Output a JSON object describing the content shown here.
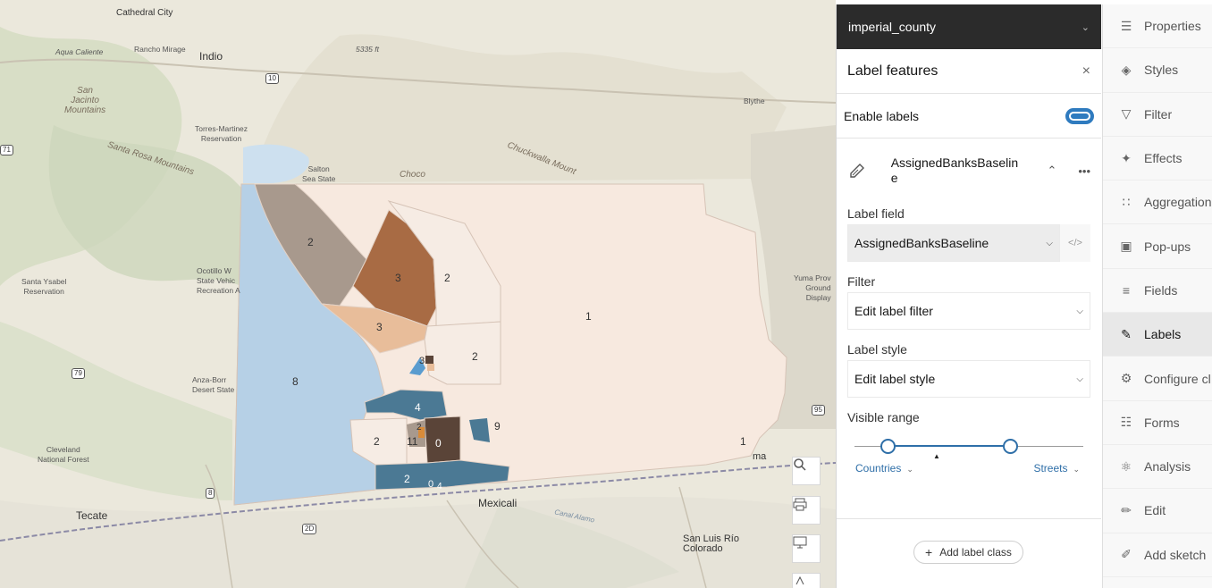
{
  "map": {
    "places": {
      "cathedral_city": "Cathedral City",
      "rancho_mirage": "Rancho Mirage",
      "indio": "Indio",
      "aqua_caliente": "Aqua Caliente",
      "elev": "5335 ft",
      "san_jacinto": "San\nJacinto\nMountains",
      "torres_martinez": "Torres-Martinez\nReservation",
      "santa_rosa": "Santa Rosa Mountains",
      "salton": "Salton\nSea State",
      "blythe": "Blythe",
      "chuckwalla": "Chuckwalla Mount",
      "santa_ysabel": "Santa Ysabel\nReservation",
      "ocotillo": "Ocotillo W\nState Vehic\nRecreation A",
      "anza_borrego": "Anza-Borr\nDesert State",
      "yuma_proving": "Yuma Prov\nGround\nDisplay",
      "cleveland": "Cleveland\nNational Forest",
      "tecate": "Tecate",
      "mexicali": "Mexicali",
      "canal_alamo": "Canal Alamo",
      "san_luis": "San Luis Río\nColorado",
      "yuma": "ma",
      "chocolate": "Choco"
    },
    "shields": {
      "i10": "10",
      "i171": "71",
      "r79": "79",
      "r8": "8",
      "r2d": "2D",
      "us95": "95"
    },
    "polygon_labels": {
      "a": "2",
      "b": "3",
      "c": "2",
      "d": "3",
      "e": "1",
      "f": "8",
      "g": "2",
      "h": "3",
      "i": "4",
      "j": "2",
      "k": "11",
      "l": "0",
      "m": "9",
      "n": "2",
      "o": "2",
      "p": "0",
      "q": "4",
      "r": "1"
    },
    "colors": {
      "base_county": "#f7e9df",
      "blue": "#b6d0e6",
      "taupe": "#a8998d",
      "brown": "#a86b44",
      "peach": "#e8bd9a",
      "teal": "#4b7994",
      "dark_brown": "#5a4438",
      "light_cream": "#f6ece4"
    }
  },
  "panel": {
    "layer_name": "imperial_county",
    "title": "Label features",
    "enable_labels": "Enable labels",
    "enable_on": true,
    "class_name": "AssignedBanksBaselin\ne",
    "label_field_title": "Label field",
    "label_field_value": "AssignedBanksBaseline",
    "filter_title": "Filter",
    "filter_value": "Edit label filter",
    "style_title": "Label style",
    "style_value": "Edit label style",
    "range_title": "Visible range",
    "range_min": "Countries",
    "range_max": "Streets",
    "add_class": "Add label class"
  },
  "toolbar": [
    {
      "label": "Properties",
      "icon": "properties-icon",
      "active": false
    },
    {
      "label": "Styles",
      "icon": "styles-icon",
      "active": false
    },
    {
      "label": "Filter",
      "icon": "filter-icon",
      "active": false
    },
    {
      "label": "Effects",
      "icon": "effects-icon",
      "active": false
    },
    {
      "label": "Aggregation",
      "icon": "aggregation-icon",
      "active": false
    },
    {
      "label": "Pop-ups",
      "icon": "popups-icon",
      "active": false
    },
    {
      "label": "Fields",
      "icon": "fields-icon",
      "active": false
    },
    {
      "label": "Labels",
      "icon": "labels-icon",
      "active": true
    },
    {
      "label": "Configure cl",
      "icon": "configure-icon",
      "active": false
    },
    {
      "label": "Forms",
      "icon": "forms-icon",
      "active": false
    },
    {
      "label": "Analysis",
      "icon": "analysis-icon",
      "active": false
    },
    {
      "label": "Edit",
      "icon": "edit-icon",
      "active": false
    },
    {
      "label": "Add sketch",
      "icon": "sketch-icon",
      "active": false
    }
  ]
}
